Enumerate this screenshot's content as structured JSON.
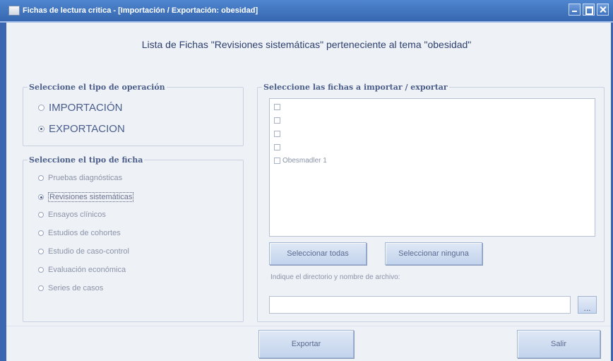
{
  "window": {
    "title": "Fichas de lectura critica - [Importación / Exportación: obesidad]"
  },
  "heading": "Lista de Fichas \"Revisiones sistemáticas\" perteneciente al tema \"obesidad\"",
  "operation": {
    "group_title": "Seleccione el tipo de operación",
    "options": [
      {
        "label": "IMPORTACIÓN",
        "checked": false
      },
      {
        "label": "EXPORTACION",
        "checked": true
      }
    ]
  },
  "ficha_type": {
    "group_title": "Seleccione el tipo de ficha",
    "options": [
      {
        "label": "Pruebas diagnósticas",
        "checked": false
      },
      {
        "label": "Revisiones sistemáticas",
        "checked": true
      },
      {
        "label": "Ensayos clínicos",
        "checked": false
      },
      {
        "label": "Estudios de cohortes",
        "checked": false
      },
      {
        "label": "Estudio de caso-control",
        "checked": false
      },
      {
        "label": "Evaluación económica",
        "checked": false
      },
      {
        "label": "Series de casos",
        "checked": false
      }
    ]
  },
  "fichas": {
    "group_title": "Seleccione las fichas a importar / exportar",
    "items": [
      {
        "label": "",
        "checked": false
      },
      {
        "label": "",
        "checked": false
      },
      {
        "label": "",
        "checked": false
      },
      {
        "label": "",
        "checked": false
      },
      {
        "label": "Obesmadler 1",
        "checked": false
      }
    ],
    "select_all_label": "Seleccionar todas",
    "select_none_label": "Seleccionar ninguna",
    "path_hint": "Indique el directorio y nombre de archivo:",
    "path_value": "",
    "browse_label": "..."
  },
  "actions": {
    "export_label": "Exportar",
    "exit_label": "Salir"
  }
}
